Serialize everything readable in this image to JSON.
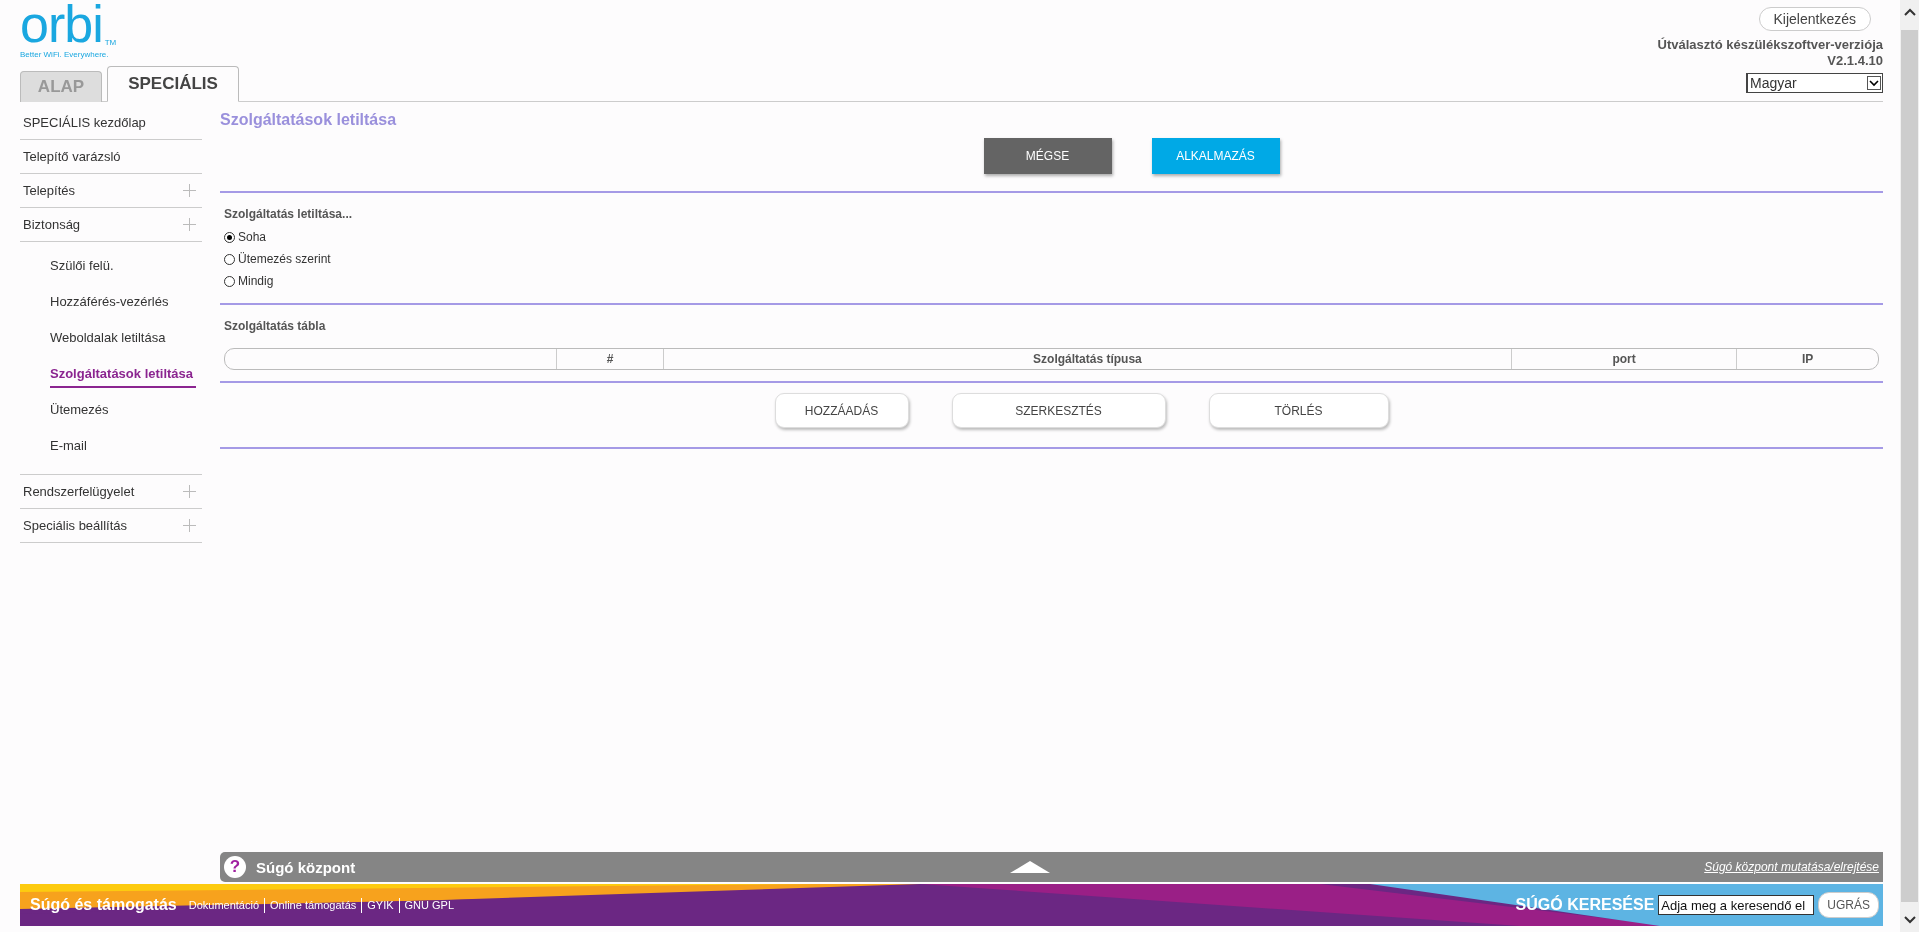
{
  "logo": {
    "name": "orbi",
    "trademark": "TM",
    "tagline": "Better WiFi. Everywhere."
  },
  "tabs": [
    {
      "label": "ALAP",
      "selected": false
    },
    {
      "label": "SPECIÁLIS",
      "selected": true
    }
  ],
  "header": {
    "logout": "Kijelentkezés",
    "firmware_label": "Útválasztó készülékszoftver-verziója",
    "firmware_version": "V2.1.4.10",
    "language": "Magyar"
  },
  "sidebar": {
    "items": [
      {
        "label": "SPECIÁLIS kezdőlap",
        "kind": "link",
        "selected": false
      },
      {
        "label": "Telepítő varázsló",
        "kind": "link",
        "selected": false
      },
      {
        "label": "Telepítés",
        "kind": "group",
        "selected": false
      },
      {
        "label": "Biztonság",
        "kind": "group",
        "selected": false,
        "children": [
          {
            "label": "Szülői felü.",
            "selected": false
          },
          {
            "label": "Hozzáférés-vezérlés",
            "selected": false
          },
          {
            "label": "Weboldalak letiltása",
            "selected": false
          },
          {
            "label": "Szolgáltatások letiltása",
            "selected": true
          },
          {
            "label": "Ütemezés",
            "selected": false
          },
          {
            "label": "E-mail",
            "selected": false
          }
        ]
      },
      {
        "label": "Rendszerfelügyelet",
        "kind": "group",
        "selected": false
      },
      {
        "label": "Speciális beállítás",
        "kind": "group",
        "selected": false
      }
    ]
  },
  "page": {
    "title": "Szolgáltatások letiltása",
    "top_buttons": [
      {
        "label": "MÉGSE",
        "kind": "dark"
      },
      {
        "label": "ALKALMAZÁS",
        "kind": "primary"
      }
    ],
    "block_label": "Szolgáltatás letiltása...",
    "options": [
      {
        "label": "Soha",
        "selected": true
      },
      {
        "label": "Ütemezés szerint",
        "selected": false
      },
      {
        "label": "Mindig",
        "selected": false
      }
    ],
    "table": {
      "title": "Szolgáltatás tábla",
      "columns": [
        "#",
        "Szolgáltatás típusa",
        "port",
        "IP"
      ]
    },
    "bottom_buttons": [
      "HOZZÁADÁS",
      "SZERKESZTÉS",
      "TÖRLÉS"
    ]
  },
  "help_bar": {
    "title": "Súgó központ",
    "icon_char": "?",
    "toggle_link": "Súgó központ mutatása/elrejtése"
  },
  "footer": {
    "title": "Súgó és támogatás",
    "links": [
      "Dokumentáció",
      "Online támogatás",
      "GYIK",
      "GNU GPL"
    ],
    "search_label": "SÚGÓ KERESÉSE",
    "search_value": "Adja meg a keresendő el",
    "go_button": "UGRÁS"
  }
}
